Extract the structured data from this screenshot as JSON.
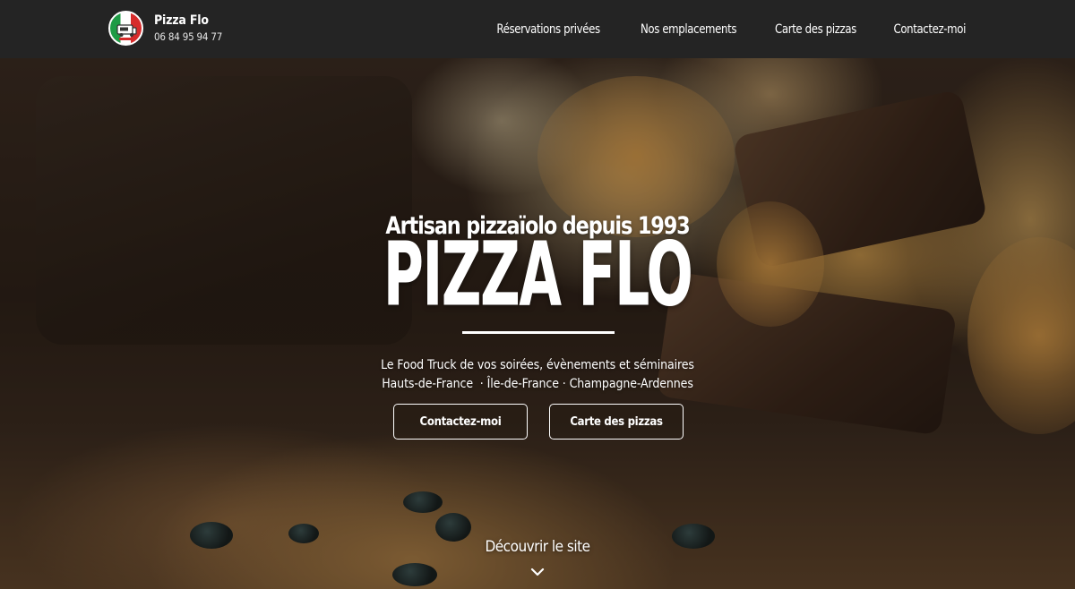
{
  "header": {
    "brand_name": "Pizza Flo",
    "phone": "06 84 95 94 77",
    "logo_icon": "food-truck-italian-flag-logo",
    "nav": [
      {
        "label": "Réservations privées"
      },
      {
        "label": "Nos emplacements"
      },
      {
        "label": "Carte des pizzas"
      },
      {
        "label": "Contactez-moi"
      }
    ]
  },
  "hero": {
    "tagline": "Artisan pizzaïolo depuis 1993",
    "title": "PIZZA FLO",
    "subtitle_line1": "Le Food Truck de vos soirées, évènements et séminaires",
    "subtitle_line2": "Hauts-de-France  · Île-de-France · Champagne-Ardennes",
    "buttons": {
      "contact": "Contactez-moi",
      "menu": "Carte des pizzas"
    },
    "discover": "Découvrir le site",
    "scroll_icon": "chevron-down-icon"
  },
  "colors": {
    "header_bg": "#242424",
    "text": "#ffffff",
    "flag_green": "#1e9b45",
    "flag_red": "#d62b2b"
  }
}
